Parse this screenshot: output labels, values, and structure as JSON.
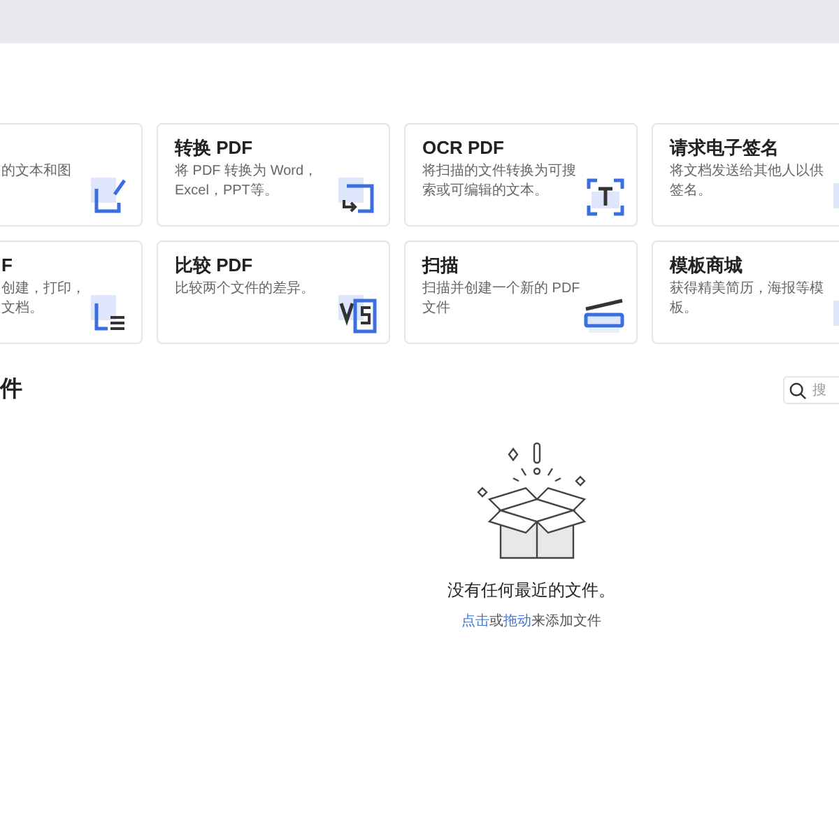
{
  "tools": [
    {
      "lines": [
        "的文本和图"
      ]
    },
    {
      "title": "转换 PDF",
      "lines": [
        "将 PDF 转换为 Word，",
        "Excel，PPT等。"
      ]
    },
    {
      "title": "OCR PDF",
      "lines": [
        "将扫描的文件转换为可搜",
        "索或可编辑的文本。"
      ]
    },
    {
      "title": "请求电子签名",
      "lines": [
        "将文档发送给其他人以供",
        "签名。"
      ]
    },
    {
      "title": "F",
      "lines": [
        "创建，打印，",
        "文档。"
      ]
    },
    {
      "title": "比较 PDF",
      "lines": [
        "比较两个文件的差异。"
      ]
    },
    {
      "title": "扫描",
      "lines": [
        "扫描并创建一个新的 PDF",
        "文件"
      ]
    },
    {
      "title": "模板商城",
      "lines": [
        "获得精美简历，海报等模",
        "板。"
      ]
    }
  ],
  "recent": {
    "title": "件",
    "search": {
      "placeholder": "搜"
    },
    "empty_message": "没有任何最近的文件。",
    "hint": [
      {
        "text": "点击",
        "kind": "link"
      },
      {
        "text": "或",
        "kind": "text"
      },
      {
        "text": "拖动",
        "kind": "link"
      },
      {
        "text": "来添加文件",
        "kind": "text"
      }
    ]
  }
}
